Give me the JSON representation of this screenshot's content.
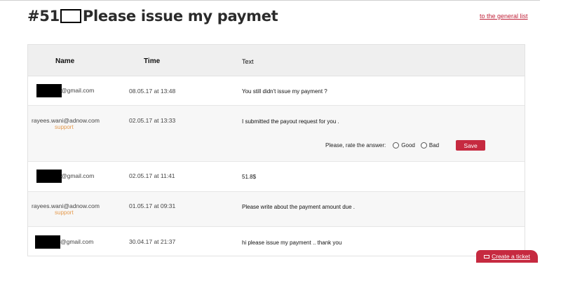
{
  "ticket": {
    "number": "#51",
    "subject": "Please issue my paymet"
  },
  "links": {
    "general_list": "to the general list"
  },
  "table": {
    "headers": {
      "name": "Name",
      "time": "Time",
      "text": "Text"
    },
    "rows": [
      {
        "name_suffix": "@gmail.com",
        "role": "",
        "time": "08.05.17 at 13:48",
        "text": "You still didn't issue my payment ?"
      },
      {
        "name": "rayees.wani@adnow.com",
        "role": "support",
        "time": "02.05.17 at 13:33",
        "text": "I submitted the payout request for you ."
      },
      {
        "name_suffix": "@gmail.com",
        "role": "",
        "time": "02.05.17 at 11:41",
        "text": "51.8$"
      },
      {
        "name": "rayees.wani@adnow.com",
        "role": "support",
        "time": "01.05.17 at 09:31",
        "text": "Please write about the payment amount due ."
      },
      {
        "name_suffix": "@gmail.com",
        "role": "",
        "time": "30.04.17 at 21:37",
        "text": "hi please issue my payment .. thank you"
      }
    ]
  },
  "rating": {
    "prompt": "Please, rate the answer:",
    "options": [
      "Good",
      "Bad"
    ],
    "save_label": "Save"
  },
  "footer": {
    "create_ticket": "Create a ticket"
  },
  "colors": {
    "accent": "#c62a40",
    "support_label": "#e59a4d",
    "header_bg": "#efefef"
  }
}
